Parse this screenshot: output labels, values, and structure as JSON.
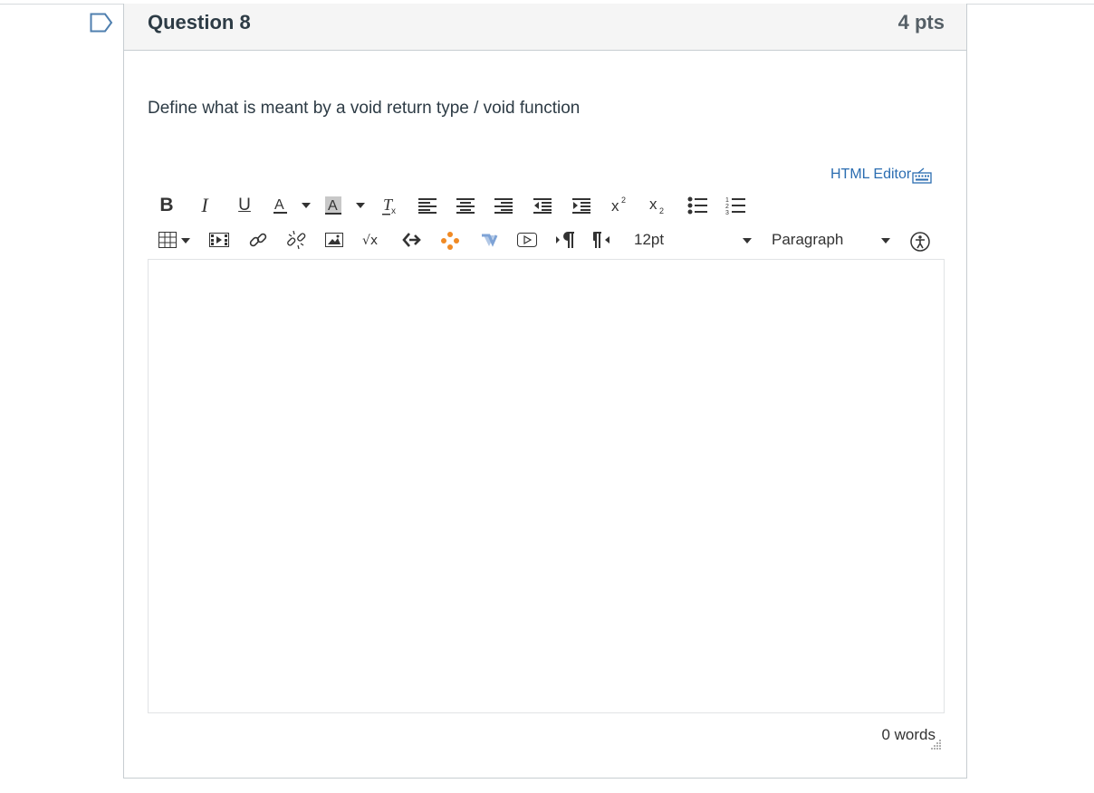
{
  "question": {
    "title": "Question 8",
    "points": "4 pts",
    "text": "Define what is meant by a void return type / void function"
  },
  "editor": {
    "html_editor_label": "HTML Editor",
    "font_size": "12pt",
    "block_format": "Paragraph",
    "word_count": "0 words",
    "toolbar_row1": [
      "bold",
      "italic",
      "underline",
      "text-color",
      "background-color",
      "clear-formatting",
      "align-left",
      "align-center",
      "align-right",
      "outdent",
      "indent",
      "superscript",
      "subscript",
      "bullet-list",
      "numbered-list"
    ],
    "toolbar_row2": [
      "table",
      "media",
      "link",
      "unlink",
      "image",
      "equation",
      "embed",
      "apps",
      "vimeo",
      "video",
      "ltr",
      "rtl",
      "font-size",
      "paragraph",
      "accessibility"
    ]
  },
  "colors": {
    "link": "#2b6db1",
    "apps_orange": "#f08a24",
    "vimeo_blue": "#7ea3d6"
  }
}
